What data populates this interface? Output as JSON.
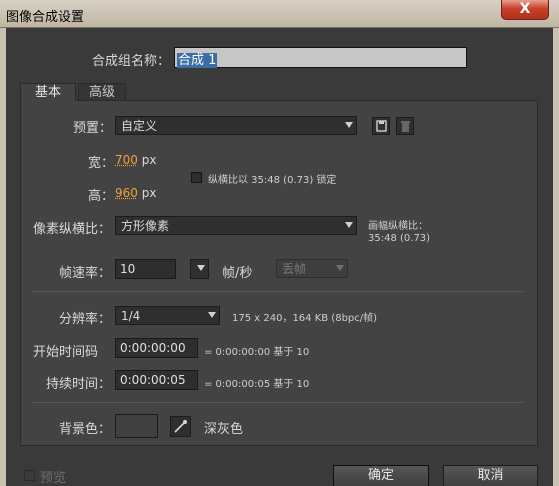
{
  "window": {
    "title": "图像合成设置",
    "close_label": "X"
  },
  "comp_name": {
    "label": "合成组名称：",
    "value": "合成 1"
  },
  "tabs": [
    {
      "label": "基本"
    },
    {
      "label": "高级"
    }
  ],
  "preset": {
    "label": "预置：",
    "value": "自定义"
  },
  "width": {
    "label": "宽：",
    "value": "700",
    "unit": "px"
  },
  "height": {
    "label": "高：",
    "value": "960",
    "unit": "px"
  },
  "lock_aspect": {
    "label": "纵横比以 35:48 (0.73) 锁定",
    "checked": false
  },
  "pixel_aspect": {
    "label": "像素纵横比：",
    "value": "方形像素",
    "frame_label": "画幅纵横比：",
    "frame_value": "35:48 (0.73)"
  },
  "frame_rate": {
    "label": "帧速率：",
    "value": "10",
    "unit": "帧/秒",
    "drop_frame": "丢帧"
  },
  "resolution": {
    "label": "分辨率：",
    "value": "1/4",
    "info": "175 x 240，164 KB (8bpc/帧)"
  },
  "start_timecode": {
    "label": "开始时间码",
    "value": "0:00:00:00",
    "info": "= 0:00:00:00  基于 10"
  },
  "duration": {
    "label": "持续时间：",
    "value": "0:00:00:05",
    "info": "= 0:00:00:05  基于 10"
  },
  "background": {
    "label": "背景色：",
    "color": "#404040",
    "name": "深灰色"
  },
  "footer": {
    "preview_label": "预览",
    "ok_label": "确定",
    "cancel_label": "取消"
  },
  "colors": {
    "accent": "#e9a23b",
    "selection": "#3b6ea5"
  }
}
